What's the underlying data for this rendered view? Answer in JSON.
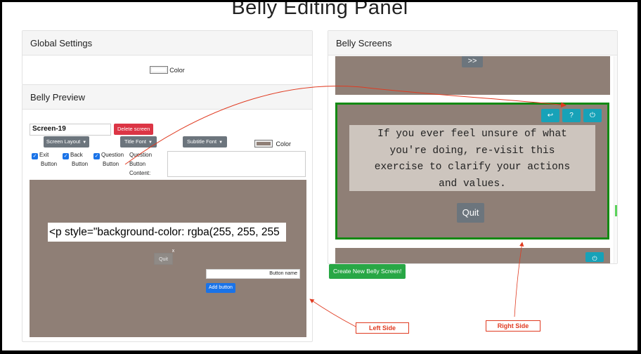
{
  "page": {
    "title": "Belly Editing Panel"
  },
  "global_settings": {
    "header": "Global Settings",
    "color_label": "Color"
  },
  "belly_preview": {
    "header": "Belly Preview",
    "screen_name_value": "Screen-19",
    "delete_button": "Delete screen",
    "dropdowns": {
      "screen_layout": "Screen Layout",
      "title_font": "Title Font",
      "subtitle_font": "Subtitle Font"
    },
    "color_label": "Color",
    "checkboxes": {
      "exit": {
        "line1": "Exit",
        "line2": "Button",
        "checked": true
      },
      "back": {
        "line1": "Back",
        "line2": "Button",
        "checked": true
      },
      "question": {
        "line1": "Question",
        "line2": "Button",
        "checked": true
      }
    },
    "question_content_label": {
      "line1": "Question",
      "line2": "Button",
      "line3": "Content:"
    },
    "preview_text": "<p style=\"background-color: rgba(255, 255, 255",
    "quit_label": "Quit",
    "quit_close": "x",
    "button_name_value": "Button name",
    "add_button": "Add button"
  },
  "belly_screens": {
    "header": "Belly Screens",
    "next_label": ">>",
    "screen_text": [
      "If you ever feel unsure of what",
      "you're doing, re-visit this",
      "exercise to clarify your actions",
      "and values."
    ],
    "quit_label": "Quit",
    "controls": {
      "back_icon": "↩",
      "help_icon": "?",
      "power_icon": "⏻"
    },
    "bottom_power_icon": "⏻"
  },
  "create_button": "Create New Belly Screen!",
  "annotations": {
    "left": "Left Side",
    "right": "Right Side"
  },
  "colors": {
    "screen_bg": "#8f7f76",
    "highlight_border": "#138a13",
    "annotation": "#e03a20"
  }
}
